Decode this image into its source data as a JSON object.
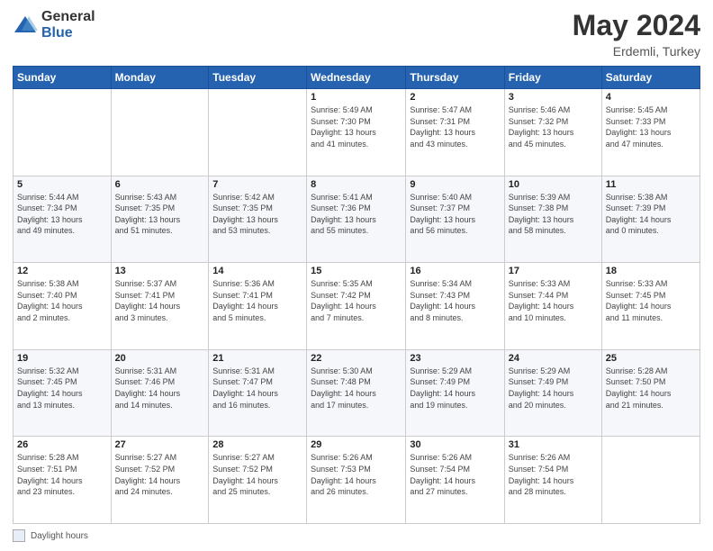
{
  "header": {
    "logo_general": "General",
    "logo_blue": "Blue",
    "title": "May 2024",
    "location": "Erdemli, Turkey"
  },
  "days_of_week": [
    "Sunday",
    "Monday",
    "Tuesday",
    "Wednesday",
    "Thursday",
    "Friday",
    "Saturday"
  ],
  "footer": {
    "daylight_label": "Daylight hours"
  },
  "weeks": [
    {
      "days": [
        {
          "num": "",
          "info": ""
        },
        {
          "num": "",
          "info": ""
        },
        {
          "num": "",
          "info": ""
        },
        {
          "num": "1",
          "info": "Sunrise: 5:49 AM\nSunset: 7:30 PM\nDaylight: 13 hours\nand 41 minutes."
        },
        {
          "num": "2",
          "info": "Sunrise: 5:47 AM\nSunset: 7:31 PM\nDaylight: 13 hours\nand 43 minutes."
        },
        {
          "num": "3",
          "info": "Sunrise: 5:46 AM\nSunset: 7:32 PM\nDaylight: 13 hours\nand 45 minutes."
        },
        {
          "num": "4",
          "info": "Sunrise: 5:45 AM\nSunset: 7:33 PM\nDaylight: 13 hours\nand 47 minutes."
        }
      ]
    },
    {
      "days": [
        {
          "num": "5",
          "info": "Sunrise: 5:44 AM\nSunset: 7:34 PM\nDaylight: 13 hours\nand 49 minutes."
        },
        {
          "num": "6",
          "info": "Sunrise: 5:43 AM\nSunset: 7:35 PM\nDaylight: 13 hours\nand 51 minutes."
        },
        {
          "num": "7",
          "info": "Sunrise: 5:42 AM\nSunset: 7:35 PM\nDaylight: 13 hours\nand 53 minutes."
        },
        {
          "num": "8",
          "info": "Sunrise: 5:41 AM\nSunset: 7:36 PM\nDaylight: 13 hours\nand 55 minutes."
        },
        {
          "num": "9",
          "info": "Sunrise: 5:40 AM\nSunset: 7:37 PM\nDaylight: 13 hours\nand 56 minutes."
        },
        {
          "num": "10",
          "info": "Sunrise: 5:39 AM\nSunset: 7:38 PM\nDaylight: 13 hours\nand 58 minutes."
        },
        {
          "num": "11",
          "info": "Sunrise: 5:38 AM\nSunset: 7:39 PM\nDaylight: 14 hours\nand 0 minutes."
        }
      ]
    },
    {
      "days": [
        {
          "num": "12",
          "info": "Sunrise: 5:38 AM\nSunset: 7:40 PM\nDaylight: 14 hours\nand 2 minutes."
        },
        {
          "num": "13",
          "info": "Sunrise: 5:37 AM\nSunset: 7:41 PM\nDaylight: 14 hours\nand 3 minutes."
        },
        {
          "num": "14",
          "info": "Sunrise: 5:36 AM\nSunset: 7:41 PM\nDaylight: 14 hours\nand 5 minutes."
        },
        {
          "num": "15",
          "info": "Sunrise: 5:35 AM\nSunset: 7:42 PM\nDaylight: 14 hours\nand 7 minutes."
        },
        {
          "num": "16",
          "info": "Sunrise: 5:34 AM\nSunset: 7:43 PM\nDaylight: 14 hours\nand 8 minutes."
        },
        {
          "num": "17",
          "info": "Sunrise: 5:33 AM\nSunset: 7:44 PM\nDaylight: 14 hours\nand 10 minutes."
        },
        {
          "num": "18",
          "info": "Sunrise: 5:33 AM\nSunset: 7:45 PM\nDaylight: 14 hours\nand 11 minutes."
        }
      ]
    },
    {
      "days": [
        {
          "num": "19",
          "info": "Sunrise: 5:32 AM\nSunset: 7:45 PM\nDaylight: 14 hours\nand 13 minutes."
        },
        {
          "num": "20",
          "info": "Sunrise: 5:31 AM\nSunset: 7:46 PM\nDaylight: 14 hours\nand 14 minutes."
        },
        {
          "num": "21",
          "info": "Sunrise: 5:31 AM\nSunset: 7:47 PM\nDaylight: 14 hours\nand 16 minutes."
        },
        {
          "num": "22",
          "info": "Sunrise: 5:30 AM\nSunset: 7:48 PM\nDaylight: 14 hours\nand 17 minutes."
        },
        {
          "num": "23",
          "info": "Sunrise: 5:29 AM\nSunset: 7:49 PM\nDaylight: 14 hours\nand 19 minutes."
        },
        {
          "num": "24",
          "info": "Sunrise: 5:29 AM\nSunset: 7:49 PM\nDaylight: 14 hours\nand 20 minutes."
        },
        {
          "num": "25",
          "info": "Sunrise: 5:28 AM\nSunset: 7:50 PM\nDaylight: 14 hours\nand 21 minutes."
        }
      ]
    },
    {
      "days": [
        {
          "num": "26",
          "info": "Sunrise: 5:28 AM\nSunset: 7:51 PM\nDaylight: 14 hours\nand 23 minutes."
        },
        {
          "num": "27",
          "info": "Sunrise: 5:27 AM\nSunset: 7:52 PM\nDaylight: 14 hours\nand 24 minutes."
        },
        {
          "num": "28",
          "info": "Sunrise: 5:27 AM\nSunset: 7:52 PM\nDaylight: 14 hours\nand 25 minutes."
        },
        {
          "num": "29",
          "info": "Sunrise: 5:26 AM\nSunset: 7:53 PM\nDaylight: 14 hours\nand 26 minutes."
        },
        {
          "num": "30",
          "info": "Sunrise: 5:26 AM\nSunset: 7:54 PM\nDaylight: 14 hours\nand 27 minutes."
        },
        {
          "num": "31",
          "info": "Sunrise: 5:26 AM\nSunset: 7:54 PM\nDaylight: 14 hours\nand 28 minutes."
        },
        {
          "num": "",
          "info": ""
        }
      ]
    }
  ]
}
